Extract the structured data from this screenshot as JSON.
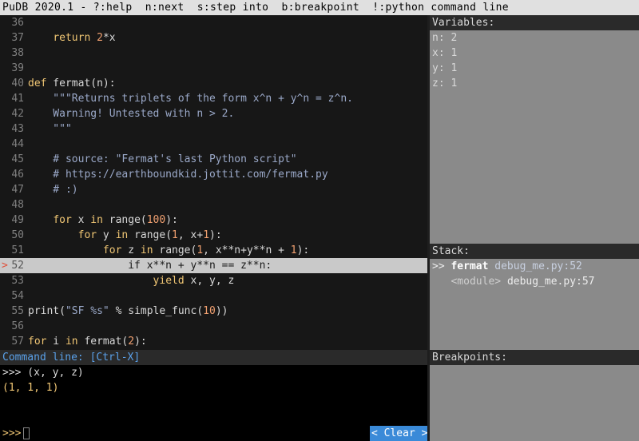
{
  "title": "PuDB 2020.1 - ?:help  n:next  s:step into  b:breakpoint  !:python command line",
  "source": {
    "current_marker": ">",
    "lines": [
      {
        "n": "36",
        "tokens": [
          {
            "t": "",
            "c": ""
          }
        ]
      },
      {
        "n": "37",
        "tokens": [
          {
            "t": "    ",
            "c": ""
          },
          {
            "t": "return",
            "c": "kw"
          },
          {
            "t": " ",
            "c": ""
          },
          {
            "t": "2",
            "c": "num"
          },
          {
            "t": "*x",
            "c": ""
          }
        ]
      },
      {
        "n": "38",
        "tokens": [
          {
            "t": "",
            "c": ""
          }
        ]
      },
      {
        "n": "39",
        "tokens": [
          {
            "t": "",
            "c": ""
          }
        ]
      },
      {
        "n": "40",
        "tokens": [
          {
            "t": "def",
            "c": "kw"
          },
          {
            "t": " fermat(n):",
            "c": ""
          }
        ]
      },
      {
        "n": "41",
        "tokens": [
          {
            "t": "    \"\"\"Returns triplets of the form x^n + y^n = z^n.",
            "c": "str"
          }
        ]
      },
      {
        "n": "42",
        "tokens": [
          {
            "t": "    Warning! Untested with n > 2.",
            "c": "str"
          }
        ]
      },
      {
        "n": "43",
        "tokens": [
          {
            "t": "    \"\"\"",
            "c": "str"
          }
        ]
      },
      {
        "n": "44",
        "tokens": [
          {
            "t": "",
            "c": ""
          }
        ]
      },
      {
        "n": "45",
        "tokens": [
          {
            "t": "    # source: \"Fermat's last Python script\"",
            "c": "com"
          }
        ]
      },
      {
        "n": "46",
        "tokens": [
          {
            "t": "    # https://earthboundkid.jottit.com/fermat.py",
            "c": "com"
          }
        ]
      },
      {
        "n": "47",
        "tokens": [
          {
            "t": "    # :)",
            "c": "com"
          }
        ]
      },
      {
        "n": "48",
        "tokens": [
          {
            "t": "",
            "c": ""
          }
        ]
      },
      {
        "n": "49",
        "tokens": [
          {
            "t": "    ",
            "c": ""
          },
          {
            "t": "for",
            "c": "kw"
          },
          {
            "t": " x ",
            "c": ""
          },
          {
            "t": "in",
            "c": "kw"
          },
          {
            "t": " range(",
            "c": ""
          },
          {
            "t": "100",
            "c": "num"
          },
          {
            "t": "):",
            "c": ""
          }
        ]
      },
      {
        "n": "50",
        "tokens": [
          {
            "t": "        ",
            "c": ""
          },
          {
            "t": "for",
            "c": "kw"
          },
          {
            "t": " y ",
            "c": ""
          },
          {
            "t": "in",
            "c": "kw"
          },
          {
            "t": " range(",
            "c": ""
          },
          {
            "t": "1",
            "c": "num"
          },
          {
            "t": ", x+",
            "c": ""
          },
          {
            "t": "1",
            "c": "num"
          },
          {
            "t": "):",
            "c": ""
          }
        ]
      },
      {
        "n": "51",
        "tokens": [
          {
            "t": "            ",
            "c": ""
          },
          {
            "t": "for",
            "c": "kw"
          },
          {
            "t": " z ",
            "c": ""
          },
          {
            "t": "in",
            "c": "kw"
          },
          {
            "t": " range(",
            "c": ""
          },
          {
            "t": "1",
            "c": "num"
          },
          {
            "t": ", x**n+y**n + ",
            "c": ""
          },
          {
            "t": "1",
            "c": "num"
          },
          {
            "t": "):",
            "c": ""
          }
        ]
      },
      {
        "n": "52",
        "current": true,
        "tokens": [
          {
            "t": "                if x**n + y**n == z**n:",
            "c": ""
          }
        ]
      },
      {
        "n": "53",
        "tokens": [
          {
            "t": "                    ",
            "c": ""
          },
          {
            "t": "yield",
            "c": "kw"
          },
          {
            "t": " x, y, z",
            "c": ""
          }
        ]
      },
      {
        "n": "54",
        "tokens": [
          {
            "t": "",
            "c": ""
          }
        ]
      },
      {
        "n": "55",
        "tokens": [
          {
            "t": "print(",
            "c": ""
          },
          {
            "t": "\"SF %s\"",
            "c": "str"
          },
          {
            "t": " % simple_func(",
            "c": ""
          },
          {
            "t": "10",
            "c": "num"
          },
          {
            "t": "))",
            "c": ""
          }
        ]
      },
      {
        "n": "56",
        "tokens": [
          {
            "t": "",
            "c": ""
          }
        ]
      },
      {
        "n": "57",
        "tokens": [
          {
            "t": "for",
            "c": "kw"
          },
          {
            "t": " i ",
            "c": ""
          },
          {
            "t": "in",
            "c": "kw"
          },
          {
            "t": " fermat(",
            "c": ""
          },
          {
            "t": "2",
            "c": "num"
          },
          {
            "t": "):",
            "c": ""
          }
        ]
      }
    ]
  },
  "variables": {
    "header": "Variables:",
    "items": [
      {
        "name": "n",
        "value": "2"
      },
      {
        "name": "x",
        "value": "1"
      },
      {
        "name": "y",
        "value": "1"
      },
      {
        "name": "z",
        "value": "1"
      }
    ]
  },
  "stack": {
    "header": "Stack:",
    "frames": [
      {
        "prefix": ">> ",
        "func": "fermat",
        "location": "debug_me.py:52",
        "current": true
      },
      {
        "prefix": "   ",
        "func": "<module>",
        "location": "debug_me.py:57",
        "current": false
      }
    ]
  },
  "breakpoints": {
    "header": "Breakpoints:"
  },
  "command_line": {
    "header": "Command line: [Ctrl-X]",
    "output": [
      {
        "text": ">>> (x, y, z)",
        "kind": "in"
      },
      {
        "text": "(1, 1, 1)",
        "kind": "res"
      }
    ],
    "prompt": ">>>",
    "input_value": "",
    "clear_label": "< Clear >"
  },
  "colors": {
    "keyword": "#f0c674",
    "string": "#9aa8c8",
    "number": "#f0a070",
    "current_line_bg": "#c9c9c9",
    "clear_button_bg": "#3a8ad8",
    "command_header_text": "#5aa0e8"
  }
}
